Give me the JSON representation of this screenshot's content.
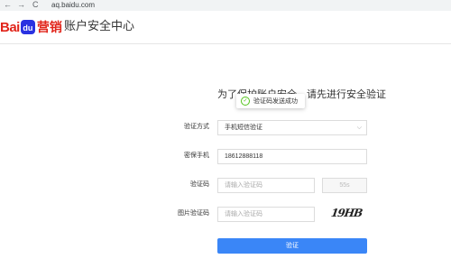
{
  "browser": {
    "back_glyph": "←",
    "forward_glyph": "→",
    "reload_glyph": "C",
    "url": "aq.baidu.com"
  },
  "header": {
    "logo_part1": "Bai",
    "logo_paw": "du",
    "logo_part2": "营销",
    "title": "账户安全中心"
  },
  "main": {
    "title": "为了保护账户安全，请先进行安全验证",
    "toast": "验证码发送成功"
  },
  "form": {
    "method_label": "验证方式",
    "method_value": "手机短信验证",
    "phone_label": "密保手机",
    "phone_value": "18612888118",
    "code_label": "验证码",
    "code_placeholder": "请输入验证码",
    "sms_button": "55s",
    "img_code_label": "图片验证码",
    "img_code_placeholder": "请输入验证码",
    "captcha_text": "19HB",
    "submit": "验证"
  },
  "colors": {
    "brand_red": "#e1251b",
    "brand_blue": "#2932e1",
    "primary_button": "#3a86f7",
    "success": "#52c41a"
  }
}
